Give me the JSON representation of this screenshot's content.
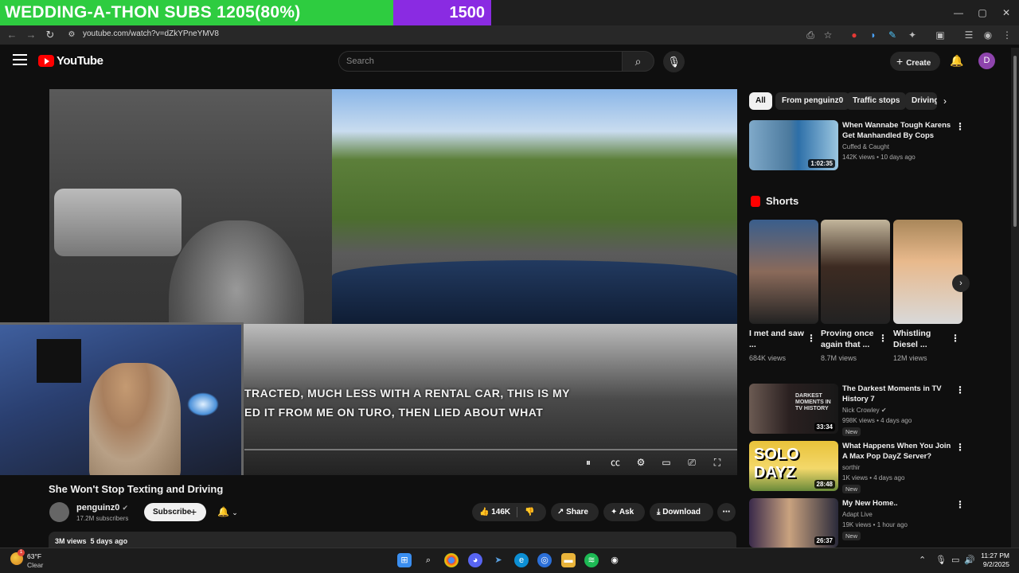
{
  "overlay": {
    "goal_text": "WEDDING-A-THON SUBS 1205(80%)",
    "goal_progress_percent": 80,
    "counter": "1500"
  },
  "browser": {
    "url": "youtube.com/watch?v=dZkYPneYMV8",
    "window_controls": {
      "minimize": "—",
      "maximize": "▢",
      "close": "✕"
    }
  },
  "header": {
    "logo_text": "YouTube",
    "search_placeholder": "Search",
    "create_label": "Create",
    "avatar_letter": "D"
  },
  "player": {
    "subtitle_line1": "TRACTED, MUCH LESS WITH A RENTAL CAR, THIS IS MY",
    "subtitle_line2": "ED IT FROM ME ON TURO, THEN LIED ABOUT WHAT"
  },
  "video": {
    "title": "She Won't Stop Texting and Driving",
    "channel": "penguinz0",
    "subscribers": "17.2M subscribers",
    "subscribe_label": "Subscribe",
    "likes": "146K",
    "share_label": "Share",
    "ask_label": "Ask",
    "download_label": "Download",
    "views": "3M views",
    "age": "5 days ago"
  },
  "sidebar": {
    "chips": [
      {
        "label": "All",
        "active": true
      },
      {
        "label": "From penguinz0",
        "active": false
      },
      {
        "label": "Traffic stops",
        "active": false
      },
      {
        "label": "Driving",
        "active": false
      }
    ],
    "top_video": {
      "title": "When Wannabe Tough Karens Get Manhandled By Cops",
      "channel": "Cuffed & Caught",
      "meta": "142K views • 10 days ago",
      "duration": "1:02:35"
    },
    "shorts_header": "Shorts",
    "shorts": [
      {
        "title": "I met and saw ...",
        "views": "684K views"
      },
      {
        "title": "Proving once again that ...",
        "views": "8.7M views"
      },
      {
        "title": "Whistling Diesel ...",
        "views": "12M views"
      }
    ],
    "videos": [
      {
        "title": "The Darkest Moments in TV History 7",
        "channel": "Nick Crowley",
        "meta": "998K views • 4 days ago",
        "badge": "New",
        "duration": "33:34"
      },
      {
        "title": "What Happens When You Join A Max Pop DayZ Server?",
        "channel": "sorthir",
        "meta": "1K views • 4 days ago",
        "badge": "New",
        "duration": "28:48"
      },
      {
        "title": "My New Home..",
        "channel": "Adapt Live",
        "meta": "19K views • 1 hour ago",
        "badge": "New",
        "duration": "26:37"
      }
    ],
    "thumb_texts": {
      "solo_dayz": "SOLO DAYZ",
      "darkest": "DARKEST MOMENTS IN TV HISTORY"
    }
  },
  "taskbar": {
    "weather_temp": "63°F",
    "weather_condition": "Clear",
    "weather_badge": "1",
    "time": "11:27 PM",
    "date": "9/2/2025"
  }
}
